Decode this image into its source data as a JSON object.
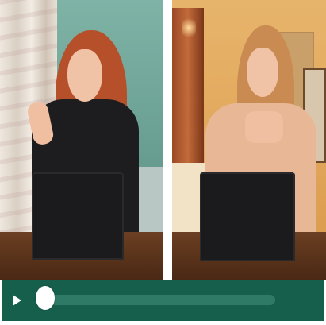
{
  "player": {
    "panels": [
      {
        "id": "left",
        "description_icon": "video-panel"
      },
      {
        "id": "right",
        "description_icon": "video-panel"
      }
    ],
    "controls": {
      "play_icon": "play-icon",
      "progress_fraction": 0.0,
      "accent_color": "#155f4c",
      "track_color": "#2f7a66",
      "thumb_color": "#ffffff"
    }
  }
}
